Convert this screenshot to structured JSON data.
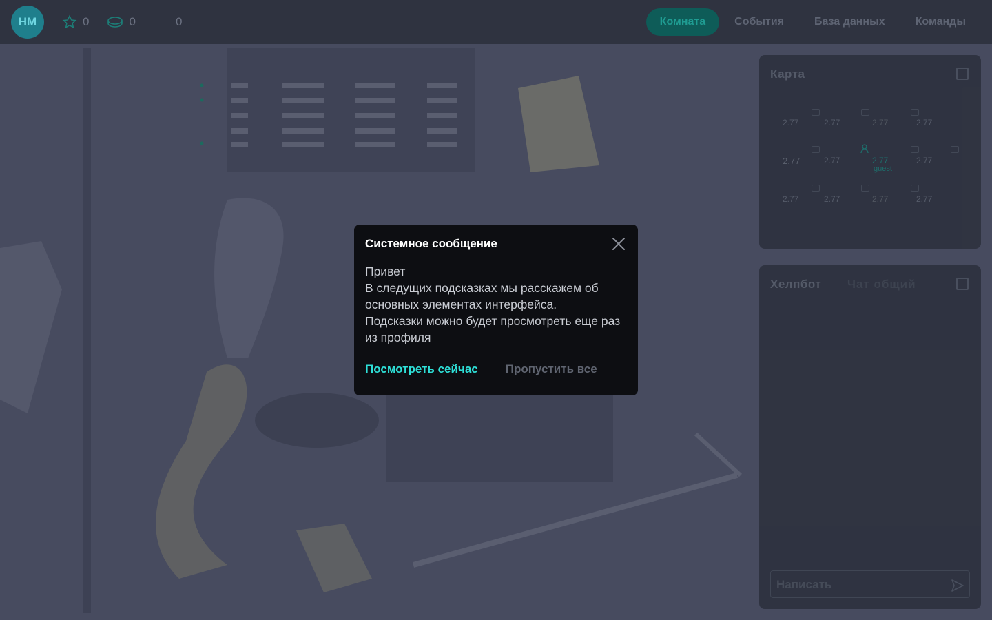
{
  "header": {
    "avatar_initials": "HM",
    "stars_count": "0",
    "coins_count": "0",
    "third_count": "0",
    "tabs": [
      {
        "label": "Комната",
        "active": true
      },
      {
        "label": "События",
        "active": false
      },
      {
        "label": "База данных",
        "active": false
      },
      {
        "label": "Команды",
        "active": false
      }
    ]
  },
  "map_panel": {
    "title": "Карта",
    "cells": [
      {
        "value": "2.77"
      },
      {
        "value": "2.77"
      },
      {
        "value": "2.77"
      },
      {
        "value": "2.77"
      },
      {
        "value": "2.77"
      },
      {
        "value": "2.77"
      },
      {
        "value": "2.77",
        "user": "guest"
      },
      {
        "value": "2.77"
      },
      {
        "value": "2.77"
      },
      {
        "value": "2.77"
      },
      {
        "value": "2.77"
      },
      {
        "value": "2.77"
      }
    ]
  },
  "chat_panel": {
    "title": "Хелпбот",
    "tab2": "Чат общий",
    "input_placeholder": "Написать"
  },
  "modal": {
    "title": "Системное сообщение",
    "greeting": "Привет",
    "line1": "В следущих подсказках мы расскажем об основных элементах интерфейса.",
    "line2": "Подсказки можно будет просмотреть еще раз из профиля",
    "primary_button": "Посмотреть сейчас",
    "secondary_button": "Пропустить все"
  },
  "colors": {
    "accent": "#2ee0d8",
    "overlay": "#4a4e62",
    "modal_bg": "#0d0e12"
  }
}
